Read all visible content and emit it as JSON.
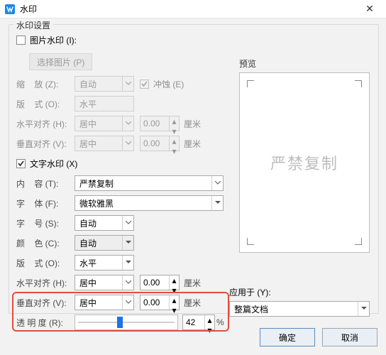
{
  "window": {
    "title": "水印",
    "close_glyph": "✕"
  },
  "fieldset_label": "水印设置",
  "image_wm": {
    "checkbox_label": "图片水印 (I):",
    "select_image_btn": "选择图片 (P)",
    "scale": {
      "label": "缩    放 (Z):",
      "value": "自动",
      "washout_label": "冲蚀 (E)"
    },
    "layout": {
      "label": "版    式 (O):",
      "value": "水平"
    },
    "halign": {
      "label": "水平对齐 (H):",
      "value": "居中",
      "offset": "0.00",
      "unit": "厘米"
    },
    "valign": {
      "label": "垂直对齐 (V):",
      "value": "居中",
      "offset": "0.00",
      "unit": "厘米"
    }
  },
  "text_wm": {
    "checkbox_label": "文字水印 (X)",
    "content": {
      "label": "内    容 (T):",
      "value": "严禁复制"
    },
    "font": {
      "label": "字    体 (F):",
      "value": "微软雅黑"
    },
    "size": {
      "label": "字    号 (S):",
      "value": "自动"
    },
    "color": {
      "label": "颜    色 (C):",
      "value": "自动"
    },
    "layout": {
      "label": "版    式 (O):",
      "value": "水平"
    },
    "halign": {
      "label": "水平对齐 (H):",
      "value": "居中",
      "offset": "0.00",
      "unit": "厘米"
    },
    "valign": {
      "label": "垂直对齐 (V):",
      "value": "居中",
      "offset": "0.00",
      "unit": "厘米"
    },
    "opacity": {
      "label": "透 明 度 (R):",
      "value": "42",
      "percent": 42,
      "unit": "%"
    }
  },
  "preview": {
    "label": "预览",
    "watermark_text": "严禁复制"
  },
  "apply": {
    "label": "应用于 (Y):",
    "value": "整篇文档"
  },
  "buttons": {
    "ok": "确定",
    "cancel": "取消"
  }
}
